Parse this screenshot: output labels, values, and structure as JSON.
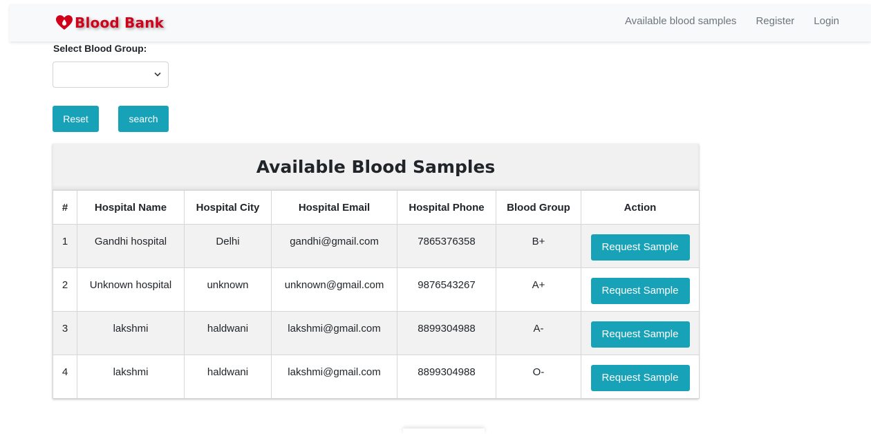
{
  "navbar": {
    "brand": "Blood Bank",
    "links": [
      "Available blood samples",
      "Register",
      "Login"
    ]
  },
  "filter": {
    "label": "Select Blood Group:",
    "selected": "",
    "reset_label": "Reset",
    "search_label": "search"
  },
  "table": {
    "title": "Available Blood Samples",
    "headers": [
      "#",
      "Hospital Name",
      "Hospital City",
      "Hospital Email",
      "Hospital Phone",
      "Blood Group",
      "Action"
    ],
    "rows": [
      {
        "num": "1",
        "name": "Gandhi hospital",
        "city": "Delhi",
        "email": "gandhi@gmail.com",
        "phone": "7865376358",
        "group": "B+",
        "action": "Request Sample"
      },
      {
        "num": "2",
        "name": "Unknown hospital",
        "city": "unknown",
        "email": "unknown@gmail.com",
        "phone": "9876543267",
        "group": "A+",
        "action": "Request Sample"
      },
      {
        "num": "3",
        "name": "lakshmi",
        "city": "haldwani",
        "email": "lakshmi@gmail.com",
        "phone": "8899304988",
        "group": "A-",
        "action": "Request Sample"
      },
      {
        "num": "4",
        "name": "lakshmi",
        "city": "haldwani",
        "email": "lakshmi@gmail.com",
        "phone": "8899304988",
        "group": "O-",
        "action": "Request Sample"
      }
    ]
  },
  "colors": {
    "brand": "#d0021b",
    "button": "#17a2b8",
    "navbar_bg": "#f8f9fa"
  },
  "icons": {
    "brand": "blood-drop-heart-icon",
    "select": "chevron-down-icon"
  }
}
